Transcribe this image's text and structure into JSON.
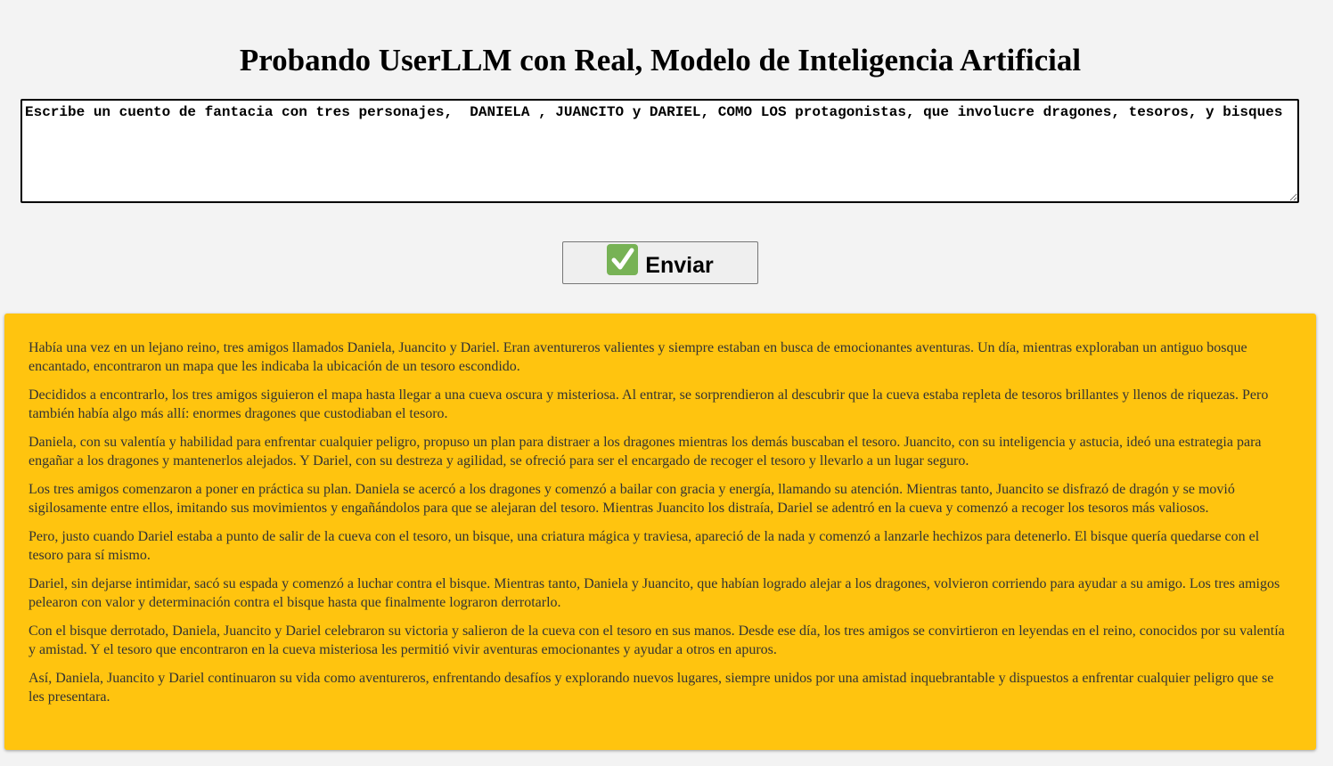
{
  "header": {
    "title": "Probando UserLLM con Real, Modelo de Inteligencia Artificial"
  },
  "prompt": {
    "value": "Escribe un cuento de fantacia con tres personajes,  DANIELA , JUANCITO y DARIEL, COMO LOS protagonistas, que involucre dragones, tesoros, y bisques"
  },
  "send_button": {
    "label": "Enviar",
    "icon": "check-icon",
    "icon_color": "#77b255"
  },
  "story": {
    "background_color": "#ffc40f",
    "paragraphs": [
      "Había una vez en un lejano reino, tres amigos llamados Daniela, Juancito y Dariel. Eran aventureros valientes y siempre estaban en busca de emocionantes aventuras. Un día, mientras exploraban un antiguo bosque encantado, encontraron un mapa que les indicaba la ubicación de un tesoro escondido.",
      "Decididos a encontrarlo, los tres amigos siguieron el mapa hasta llegar a una cueva oscura y misteriosa. Al entrar, se sorprendieron al descubrir que la cueva estaba repleta de tesoros brillantes y llenos de riquezas. Pero también había algo más allí: enormes dragones que custodiaban el tesoro.",
      "Daniela, con su valentía y habilidad para enfrentar cualquier peligro, propuso un plan para distraer a los dragones mientras los demás buscaban el tesoro. Juancito, con su inteligencia y astucia, ideó una estrategia para engañar a los dragones y mantenerlos alejados. Y Dariel, con su destreza y agilidad, se ofreció para ser el encargado de recoger el tesoro y llevarlo a un lugar seguro.",
      "Los tres amigos comenzaron a poner en práctica su plan. Daniela se acercó a los dragones y comenzó a bailar con gracia y energía, llamando su atención. Mientras tanto, Juancito se disfrazó de dragón y se movió sigilosamente entre ellos, imitando sus movimientos y engañándolos para que se alejaran del tesoro. Mientras Juancito los distraía, Dariel se adentró en la cueva y comenzó a recoger los tesoros más valiosos.",
      "Pero, justo cuando Dariel estaba a punto de salir de la cueva con el tesoro, un bisque, una criatura mágica y traviesa, apareció de la nada y comenzó a lanzarle hechizos para detenerlo. El bisque quería quedarse con el tesoro para sí mismo.",
      "Dariel, sin dejarse intimidar, sacó su espada y comenzó a luchar contra el bisque. Mientras tanto, Daniela y Juancito, que habían logrado alejar a los dragones, volvieron corriendo para ayudar a su amigo. Los tres amigos pelearon con valor y determinación contra el bisque hasta que finalmente lograron derrotarlo.",
      "Con el bisque derrotado, Daniela, Juancito y Dariel celebraron su victoria y salieron de la cueva con el tesoro en sus manos. Desde ese día, los tres amigos se convirtieron en leyendas en el reino, conocidos por su valentía y amistad. Y el tesoro que encontraron en la cueva misteriosa les permitió vivir aventuras emocionantes y ayudar a otros en apuros.",
      "Así, Daniela, Juancito y Dariel continuaron su vida como aventureros, enfrentando desafíos y explorando nuevos lugares, siempre unidos por una amistad inquebrantable y dispuestos a enfrentar cualquier peligro que se les presentara."
    ]
  }
}
